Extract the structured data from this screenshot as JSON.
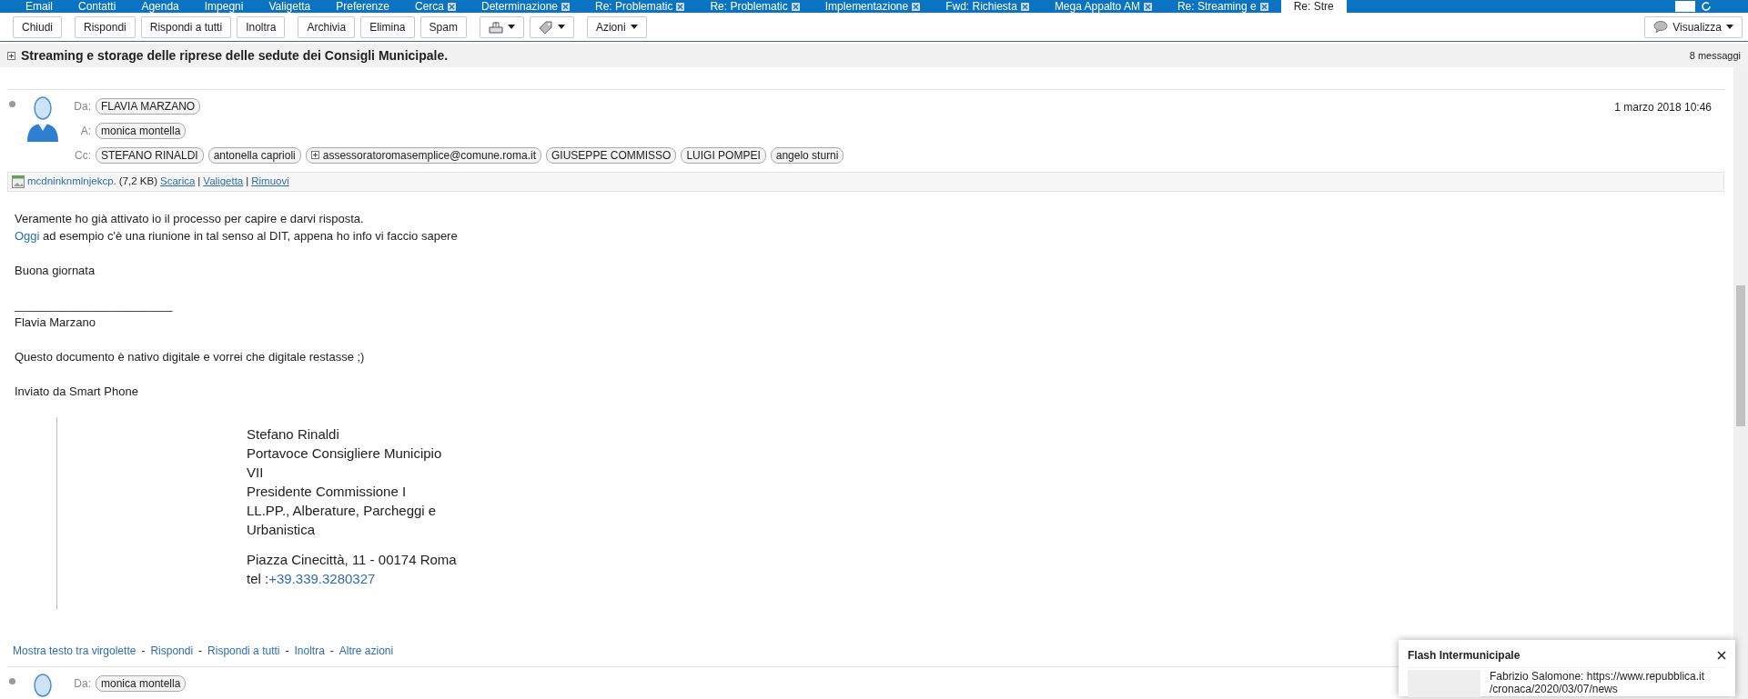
{
  "tabs": [
    {
      "label": "Email",
      "closable": false,
      "selected": false
    },
    {
      "label": "Contatti",
      "closable": false,
      "selected": false
    },
    {
      "label": "Agenda",
      "closable": false,
      "selected": false
    },
    {
      "label": "Impegni",
      "closable": false,
      "selected": false
    },
    {
      "label": "Valigetta",
      "closable": false,
      "selected": false
    },
    {
      "label": "Preferenze",
      "closable": false,
      "selected": false
    },
    {
      "label": "Cerca",
      "closable": true,
      "selected": false
    },
    {
      "label": "Determinazione",
      "closable": true,
      "selected": false
    },
    {
      "label": "Re: Problematic",
      "closable": true,
      "selected": false
    },
    {
      "label": "Re: Problematic",
      "closable": true,
      "selected": false
    },
    {
      "label": "Implementazione",
      "closable": true,
      "selected": false
    },
    {
      "label": "Fwd: Richiesta",
      "closable": true,
      "selected": false
    },
    {
      "label": "Mega Appalto AM",
      "closable": true,
      "selected": false
    },
    {
      "label": "Re: Streaming e",
      "closable": true,
      "selected": false
    },
    {
      "label": "Re: Stre",
      "closable": false,
      "selected": true
    }
  ],
  "toolbar": [
    {
      "kind": "button",
      "label": "Chiudi"
    },
    {
      "kind": "button",
      "label": "Rispondi"
    },
    {
      "kind": "button",
      "label": "Rispondi a tutti"
    },
    {
      "kind": "button",
      "label": "Inoltra"
    },
    {
      "kind": "button",
      "label": "Archivia"
    },
    {
      "kind": "button",
      "label": "Elimina"
    },
    {
      "kind": "button",
      "label": "Spam"
    },
    {
      "kind": "move-menu"
    },
    {
      "kind": "tag-menu"
    },
    {
      "kind": "menu",
      "label": "Azioni"
    }
  ],
  "view_menu": {
    "label": "Visualizza"
  },
  "conversation": {
    "subject": "Streaming e storage delle riprese delle sedute dei Consigli Municipale.",
    "count": "8 messaggi"
  },
  "messages": [
    {
      "from_label": "Da:",
      "from": "FLAVIA MARZANO",
      "to_label": "A:",
      "to": [
        "monica montella"
      ],
      "cc_label": "Cc:",
      "cc": [
        {
          "name": "STEFANO RINALDI",
          "group": false
        },
        {
          "name": "antonella caprioli",
          "group": false
        },
        {
          "name": "assessoratoromasemplice@comune.roma.it",
          "group": true
        },
        {
          "name": "GIUSEPPE COMMISSO",
          "group": false
        },
        {
          "name": "LUIGI POMPEI",
          "group": false
        },
        {
          "name": "angelo sturni",
          "group": false
        }
      ],
      "date": "1 marzo 2018 10:46",
      "attachment": {
        "name": "mcdninknmlnjekcp.",
        "size": "(7,2 KB)",
        "links": [
          "Scarica",
          "Valigetta",
          "Rimuovi"
        ],
        "separator": "|"
      },
      "body": [
        [
          {
            "text": "Veramente ho già attivato io il processo per capire e darvi risposta."
          },
          {
            "link": "Oggi",
            "text": " ad esempio c'è una riunione in tal senso al DIT, appena ho info vi faccio sapere"
          }
        ],
        [
          {
            "text": "Buona giornata"
          }
        ],
        [
          {
            "text": "________________________"
          },
          {
            "text": "Flavia Marzano"
          }
        ],
        [
          {
            "text": "Questo documento è nativo digitale e vorrei che digitale restasse ;)"
          }
        ],
        [
          {
            "text": "Inviato da Smart Phone"
          }
        ]
      ],
      "quote": [
        [
          {
            "text": "Stefano Rinaldi"
          },
          {
            "text": "Portavoce Consigliere Municipio"
          },
          {
            "text": "VII"
          },
          {
            "text": "Presidente Commissione I"
          },
          {
            "text": "LL.PP., Alberature, Parcheggi e"
          },
          {
            "text": "Urbanistica"
          }
        ],
        [
          {
            "text": "Piazza Cinecittà, 11 - 00174 Roma"
          },
          {
            "text": "tel :",
            "link": "+39.339.3280327"
          }
        ]
      ],
      "action_separator": "-",
      "actions": [
        "Mostra testo tra virgolette",
        "Rispondi",
        "Rispondi a tutti",
        "Inoltra",
        "Altre azioni"
      ]
    },
    {
      "from_label": "Da:",
      "from": "monica montella"
    }
  ],
  "notification": {
    "title": "Flash Intermunicipale",
    "lines": [
      "Fabrizio Salomone: https://www.repubblica.it",
      "/cronaca/2020/03/07/news"
    ]
  }
}
